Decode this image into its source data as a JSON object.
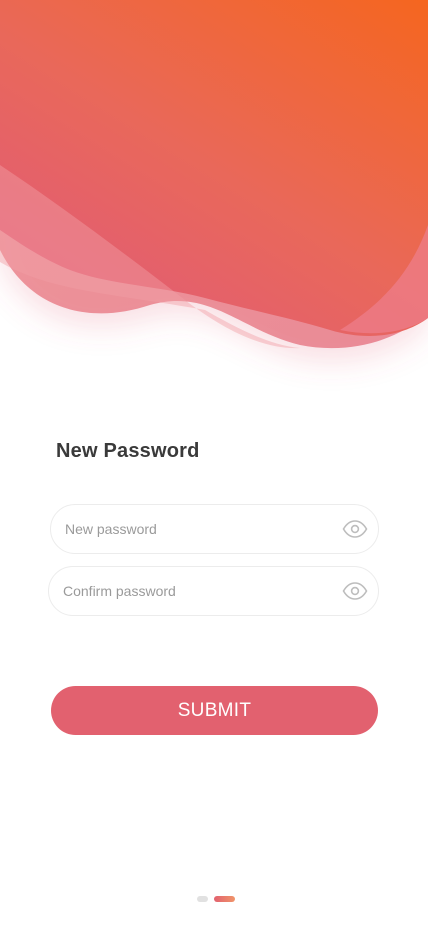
{
  "header": {
    "title": "New Password"
  },
  "form": {
    "new_password": {
      "placeholder": "New password",
      "value": ""
    },
    "confirm_password": {
      "placeholder": "Confirm password",
      "value": ""
    },
    "visibility_icon": "eye-icon",
    "submit_label": "SUBMIT"
  },
  "pagination": {
    "total": 2,
    "active_index": 1
  },
  "colors": {
    "accent": "#e2616f",
    "gradient_start": "#f5661f",
    "gradient_end": "#e15b77",
    "placeholder": "#9a9a9a"
  }
}
